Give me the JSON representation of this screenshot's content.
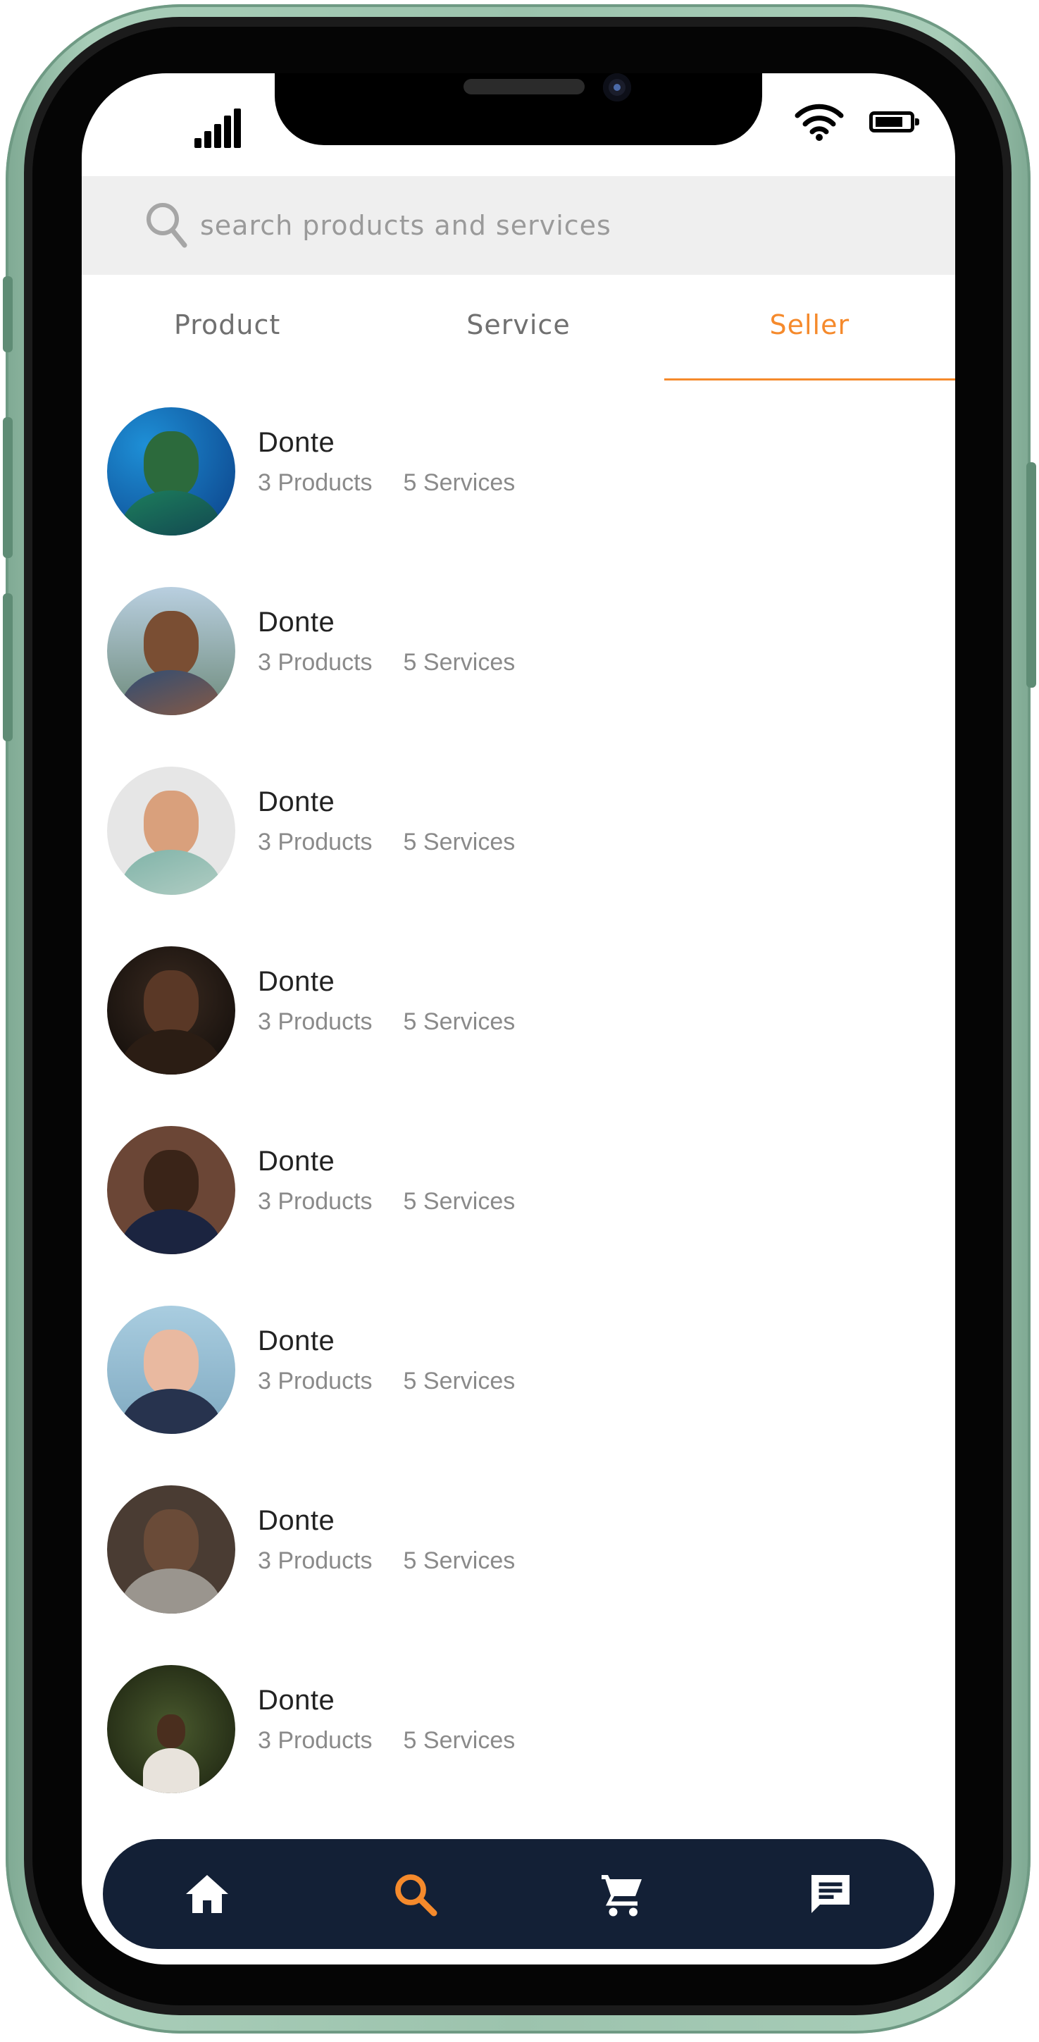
{
  "search": {
    "placeholder": "search products and services"
  },
  "tabs": [
    {
      "label": "Product",
      "active": false
    },
    {
      "label": "Service",
      "active": false
    },
    {
      "label": "Seller",
      "active": true
    }
  ],
  "sellers": [
    {
      "name": "Donte",
      "products": "3 Products",
      "services": "5 Services"
    },
    {
      "name": "Donte",
      "products": "3 Products",
      "services": "5 Services"
    },
    {
      "name": "Donte",
      "products": "3 Products",
      "services": "5 Services"
    },
    {
      "name": "Donte",
      "products": "3 Products",
      "services": "5 Services"
    },
    {
      "name": "Donte",
      "products": "3 Products",
      "services": "5 Services"
    },
    {
      "name": "Donte",
      "products": "3 Products",
      "services": "5 Services"
    },
    {
      "name": "Donte",
      "products": "3 Products",
      "services": "5 Services"
    },
    {
      "name": "Donte",
      "products": "3 Products",
      "services": "5 Services"
    }
  ],
  "bottom_nav": [
    {
      "icon": "home-icon",
      "active": false
    },
    {
      "icon": "search-icon",
      "active": true
    },
    {
      "icon": "cart-icon",
      "active": false
    },
    {
      "icon": "chat-icon",
      "active": false
    }
  ],
  "colors": {
    "accent": "#f58a2c",
    "nav_background": "#132036",
    "frame": "#9cc3ad"
  }
}
